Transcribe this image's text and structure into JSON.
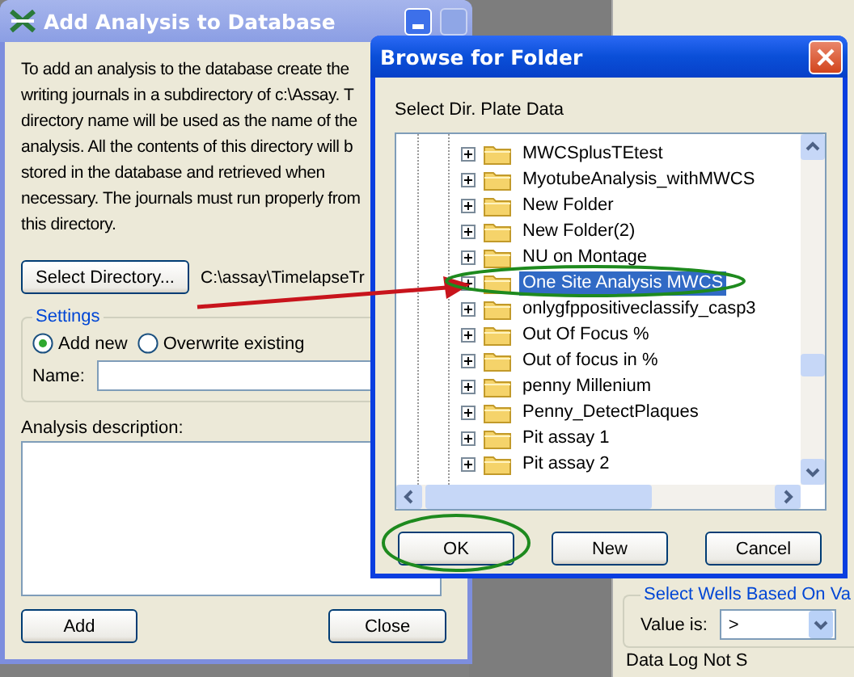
{
  "main_dialog": {
    "title": "Add Analysis to Database",
    "intro_lines": [
      "To add an analysis to the database create the",
      "writing journals in a subdirectory of c:\\Assay. T",
      "directory name will be used as the name of the",
      "analysis. All the contents of this directory will b",
      "stored in the database and retrieved when",
      "necessary. The journals must run properly from",
      "this directory."
    ],
    "select_button": "Select Directory...",
    "directory_path": "C:\\assay\\TimelapseTr",
    "settings": {
      "legend": "Settings",
      "options": [
        {
          "label": "Add new",
          "selected": true
        },
        {
          "label": "Overwrite existing",
          "selected": false
        }
      ],
      "name_label": "Name:"
    },
    "description_label": "Analysis description:",
    "buttons": [
      "Add",
      "Close"
    ]
  },
  "background_panel": {
    "group_label": "Select Wells Based On Va",
    "value_label": "Value is:",
    "value": ">",
    "footer": "Data Log Not S"
  },
  "browse_dialog": {
    "title": "Browse for Folder",
    "prompt": "Select Dir. Plate Data",
    "folders": [
      {
        "name": "MWCSplusTEtest",
        "selected": false
      },
      {
        "name": "MyotubeAnalysis_withMWCS",
        "selected": false
      },
      {
        "name": "New Folder",
        "selected": false
      },
      {
        "name": "New Folder(2)",
        "selected": false
      },
      {
        "name": "NU on Montage",
        "selected": false
      },
      {
        "name": "One Site Analysis MWCS",
        "selected": true
      },
      {
        "name": "onlygfppositiveclassify_casp3",
        "selected": false
      },
      {
        "name": "Out Of Focus %",
        "selected": false
      },
      {
        "name": "Out of focus in %",
        "selected": false
      },
      {
        "name": "penny Millenium",
        "selected": false
      },
      {
        "name": "Penny_DetectPlaques",
        "selected": false
      },
      {
        "name": "Pit assay 1",
        "selected": false
      },
      {
        "name": "Pit assay 2",
        "selected": false
      }
    ],
    "buttons": [
      "OK",
      "New",
      "Cancel"
    ]
  }
}
